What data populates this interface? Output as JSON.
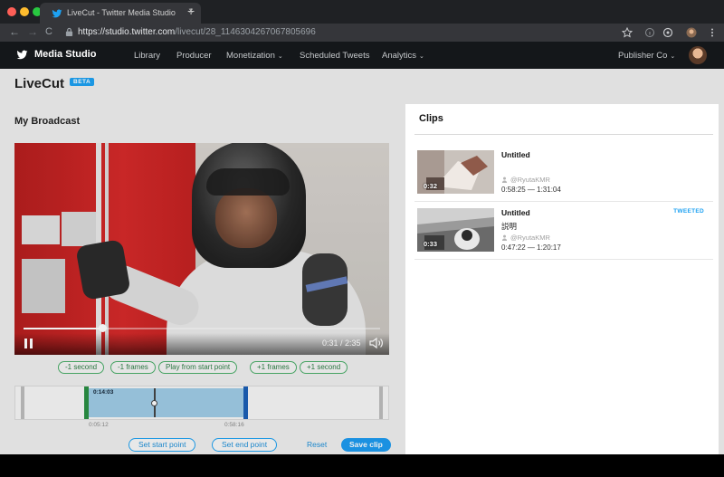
{
  "browser": {
    "tab_title": "LiveCut - Twitter Media Studio",
    "tab_close": "×",
    "new_tab": "+",
    "back": "←",
    "forward": "→",
    "reload": "C",
    "url_main": "https://studio.twitter.com",
    "url_path": "/livecut/28_1146304267067805696",
    "traffic_colors": [
      "#fe5f57",
      "#febc2e",
      "#28c840"
    ]
  },
  "header": {
    "app_title": "Media Studio",
    "nav": [
      "Library",
      "Producer",
      "Monetization",
      "Scheduled Tweets",
      "Analytics"
    ],
    "caret": "⌄",
    "account": "Publisher Co"
  },
  "page": {
    "title": "LiveCut",
    "badge": "BETA",
    "section_title": "My Broadcast"
  },
  "player": {
    "time": "0:31 / 2:35",
    "progress": 0.22
  },
  "step_buttons": [
    "-1 second",
    "-1 frames",
    "Play from start point",
    "+1 frames",
    "+1 second"
  ],
  "timeline": {
    "selection_label": "0:14:03",
    "tick_labels": [
      "0:05:12",
      "0:58:16"
    ]
  },
  "actions": {
    "set_start": "Set start point",
    "set_end": "Set end point",
    "reset": "Reset",
    "save": "Save clip"
  },
  "clips_panel": {
    "title": "Clips",
    "items": [
      {
        "title": "Untitled",
        "description": "",
        "duration": "0:32",
        "user": "@RyutaKMR",
        "range": "0:58:25 — 1:31:04",
        "badge": ""
      },
      {
        "title": "Untitled",
        "description": "説明",
        "duration": "0:33",
        "user": "@RyutaKMR",
        "range": "0:47:22 — 1:20:17",
        "badge": "TWEETED"
      }
    ]
  },
  "colors": {
    "accent": "#1da1f2",
    "header_bg": "#14171a",
    "frame_step_green": "#4cae6a"
  }
}
